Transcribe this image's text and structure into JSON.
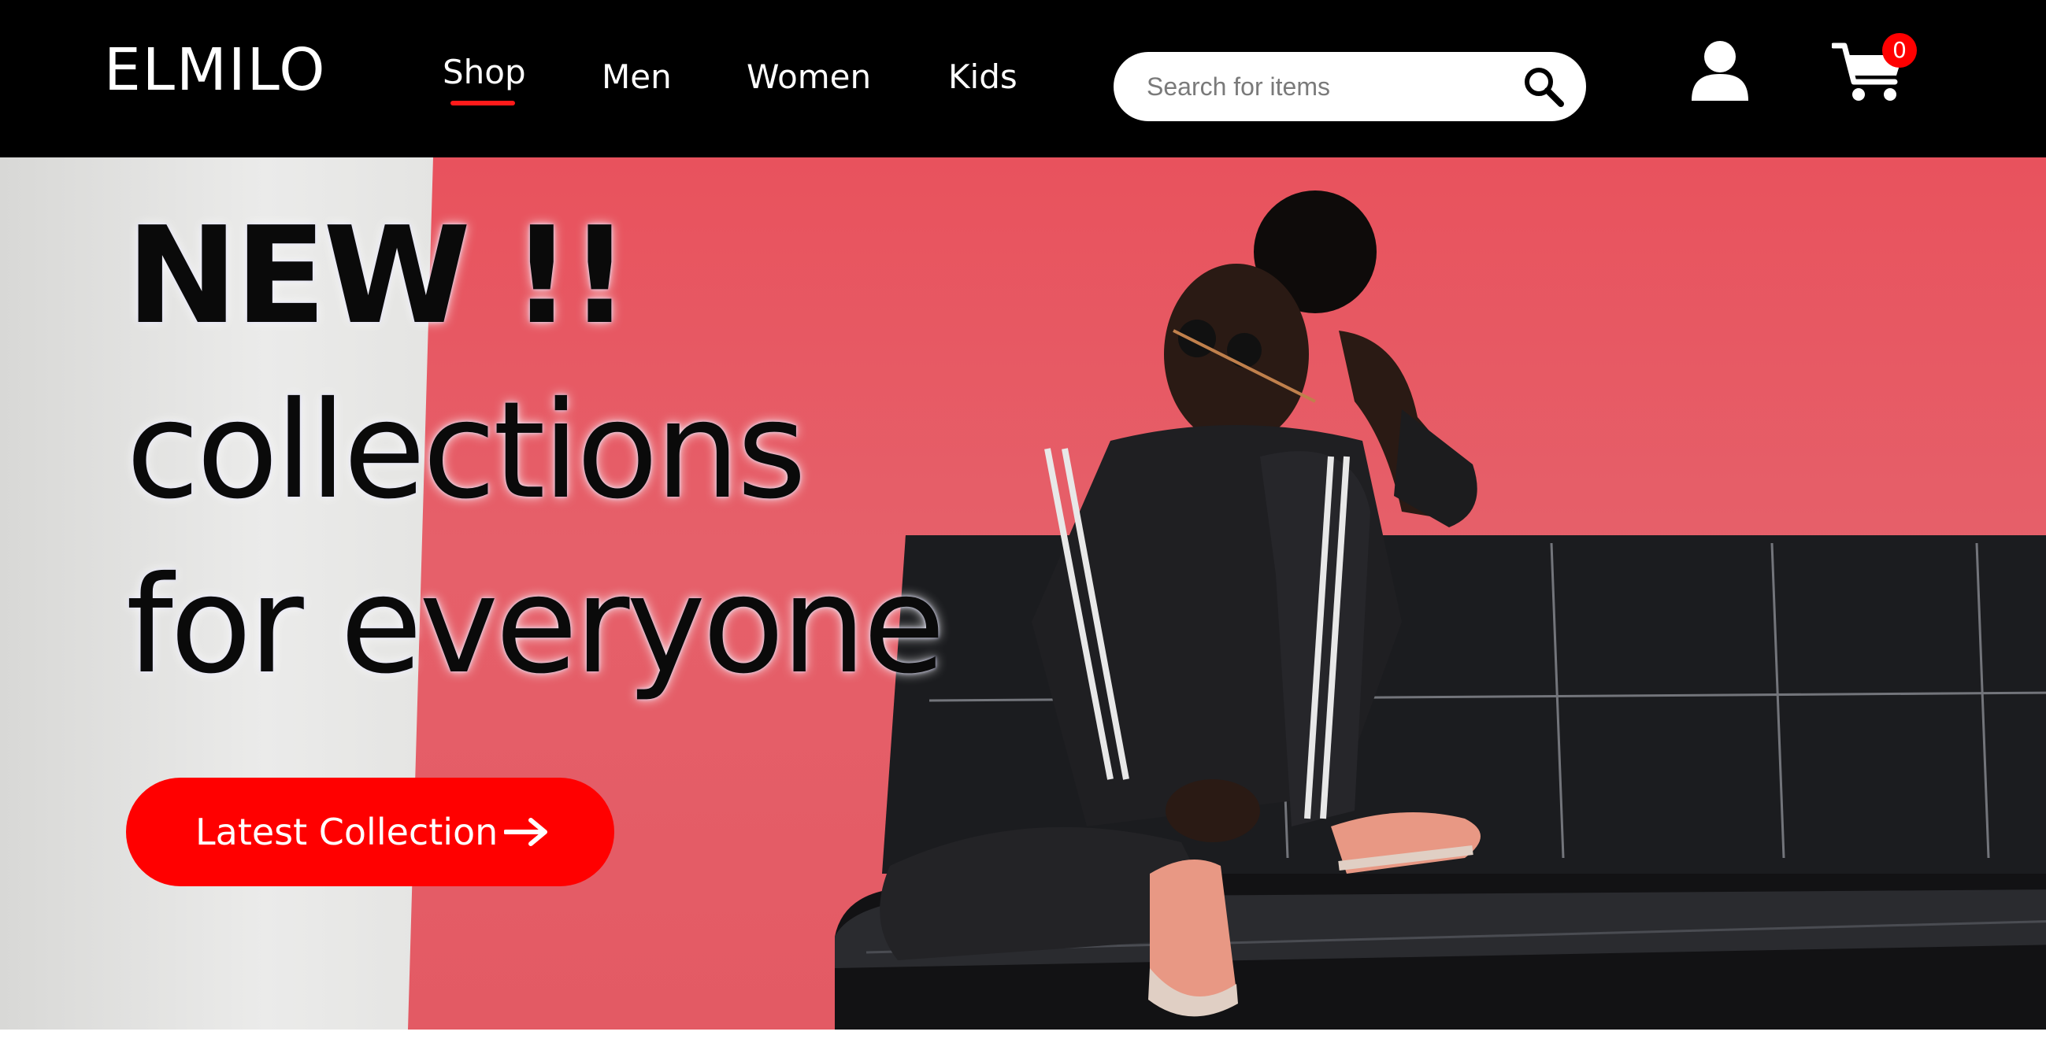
{
  "header": {
    "logo": "ELMILO",
    "nav": [
      {
        "label": "Shop"
      },
      {
        "label": "Men"
      },
      {
        "label": "Women"
      },
      {
        "label": "Kids"
      }
    ],
    "active_nav": "Shop",
    "search": {
      "placeholder": "Search for items",
      "value": ""
    },
    "cart_count": "0",
    "icons": {
      "search": "search-icon",
      "user": "user-icon",
      "cart": "cart-icon"
    }
  },
  "hero": {
    "title_lines": [
      "NEW !!",
      "collections",
      "for everyone"
    ],
    "cta_label": "Latest Collection",
    "cta_icon": "arrow-right-icon"
  },
  "colors": {
    "header_bg": "#000000",
    "accent": "#ff0000",
    "wall_red": "#e8525d",
    "wall_white": "#ebebea"
  }
}
